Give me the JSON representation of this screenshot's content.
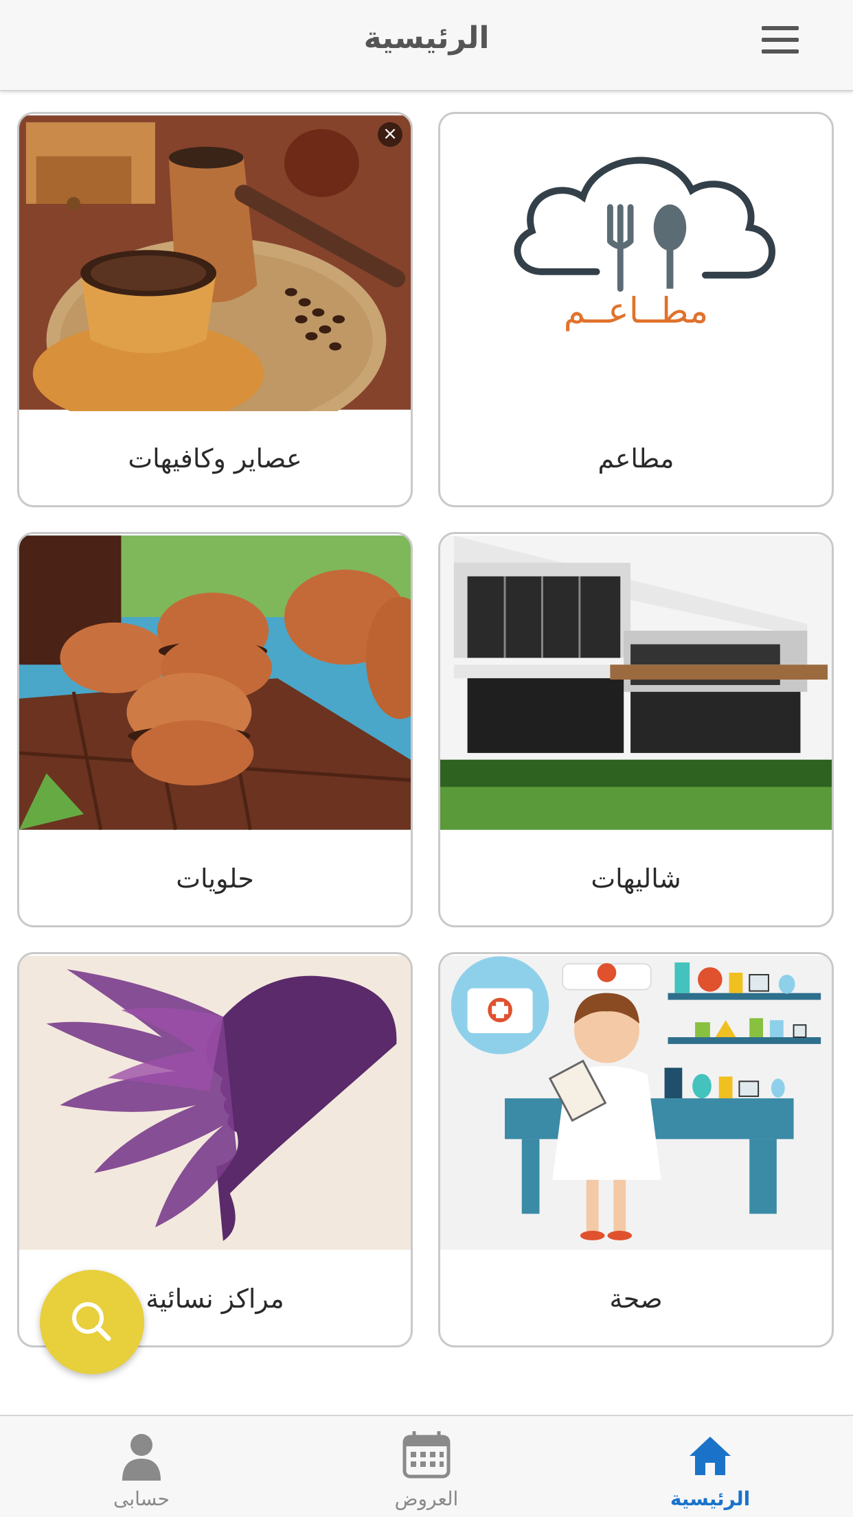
{
  "header": {
    "title": "الرئيسية",
    "menu_icon": "hamburger-menu-icon"
  },
  "categories": [
    {
      "label": "مطاعم",
      "image": "restaurants-logo",
      "logo_text": "مطــاعــم"
    },
    {
      "label": "عصاير وكافيهات",
      "image": "coffee-photo"
    },
    {
      "label": "شاليهات",
      "image": "chalet-photo"
    },
    {
      "label": "حلويات",
      "image": "macarons-photo"
    },
    {
      "label": "صحة",
      "image": "nurse-illustration"
    },
    {
      "label": "مراكز نسائية",
      "image": "woman-hair-silhouette"
    }
  ],
  "fab": {
    "icon": "search-icon",
    "color": "#e8cf3c"
  },
  "tabs": [
    {
      "label": "الرئيسية",
      "icon": "home-icon",
      "active": true
    },
    {
      "label": "العروض",
      "icon": "calendar-icon",
      "active": false
    },
    {
      "label": "حسابى",
      "icon": "person-icon",
      "active": false
    }
  ],
  "colors": {
    "accent": "#1a73c9",
    "header_bg": "#f7f7f7",
    "logo_orange": "#e0722c"
  }
}
